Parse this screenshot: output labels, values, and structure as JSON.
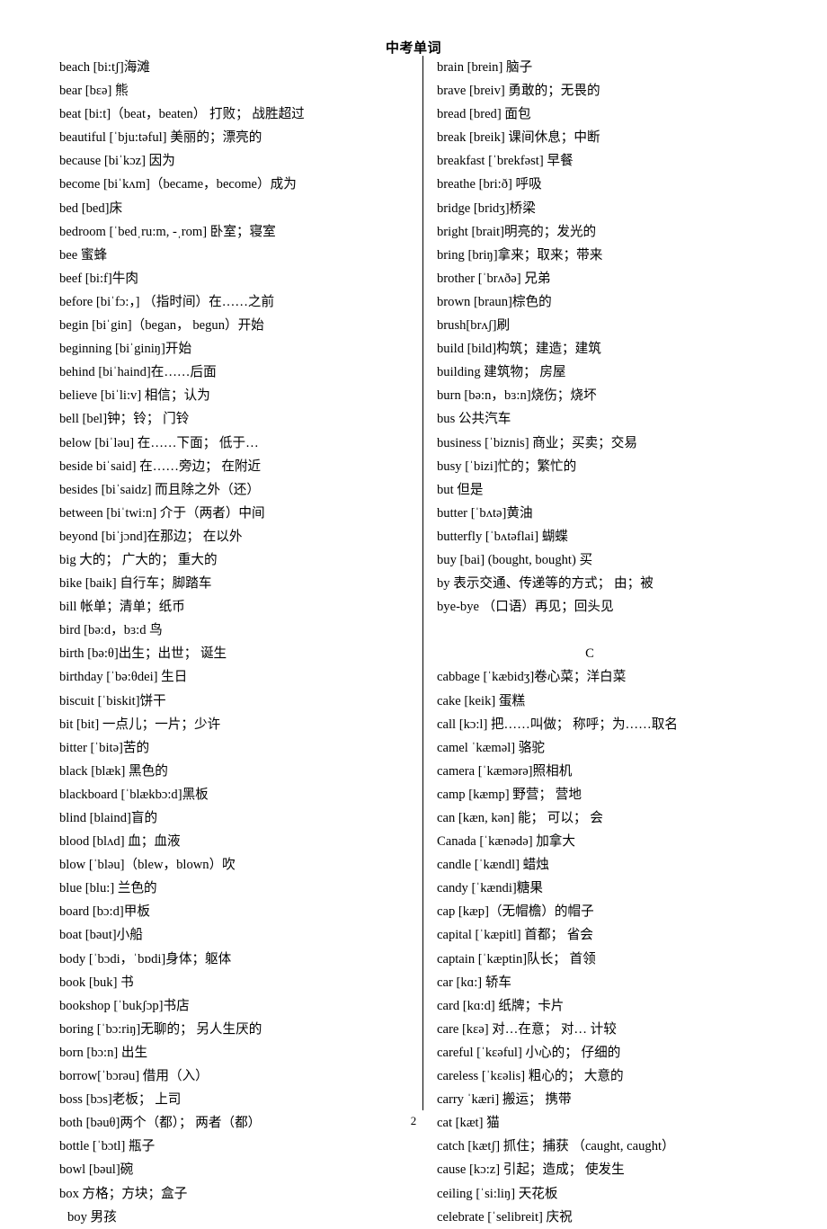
{
  "document": {
    "title": "中考单词",
    "page_number": "2"
  },
  "left_column": {
    "entries": [
      {
        "text": "beach [bi:tʃ]海滩"
      },
      {
        "text": "bear [bɛə]  熊"
      },
      {
        "text": "beat [bi:t]（beat，beaten）  打败；  战胜超过"
      },
      {
        "text": "beautiful [ˈbju:təful]  美丽的；漂亮的"
      },
      {
        "text": "because [biˈkɔz]  因为"
      },
      {
        "text": "become [biˈkʌm]（became，become）成为"
      },
      {
        "text": "bed [bed]床"
      },
      {
        "text": "bedroom [ˈbedˌru:m, -ˌrom]  卧室；寝室"
      },
      {
        "text": "bee  蜜蜂"
      },
      {
        "text": "beef [bi:f]牛肉"
      },
      {
        "text": "before [biˈfɔ:，]  （指时间）在……之前"
      },
      {
        "text": "begin [biˈgin]（began，  begun）开始"
      },
      {
        "text": "beginning   [biˈginiŋ]开始"
      },
      {
        "text": "behind [biˈhaind]在……后面"
      },
      {
        "text": "believe [biˈli:v]  相信；认为"
      },
      {
        "text": "bell [bel]钟；铃；  门铃"
      },
      {
        "text": "below [biˈləu]  在……下面；  低于…"
      },
      {
        "text": "beside biˈsaid]  在……旁边；  在附近"
      },
      {
        "text": "besides [biˈsaidz]  而且除之外（还）"
      },
      {
        "text": "between [biˈtwi:n]  介于（两者）中间"
      },
      {
        "text": "beyond [biˈjɔnd]在那边；  在以外"
      },
      {
        "text": "big  大的；  广大的；   重大的"
      },
      {
        "text": "bike [baik]  自行车；脚踏车"
      },
      {
        "text": "bill 帐单；清单；纸币"
      },
      {
        "text": "bird [bə:d，bɜ:d  鸟"
      },
      {
        "text": "birth [bə:θ]出生；出世；  诞生"
      },
      {
        "text": "birthday [ˈbə:θdei]  生日"
      },
      {
        "text": "biscuit [ˈbiskit]饼干"
      },
      {
        "text": "bit [bit]  一点儿；一片；少许"
      },
      {
        "text": "bitter [ˈbitə]苦的"
      },
      {
        "text": "black [blæk]  黑色的"
      },
      {
        "text": "blackboard [ˈblækbɔ:d]黑板"
      },
      {
        "text": "blind [blaind]盲的"
      },
      {
        "text": "blood [blʌd]  血；血液"
      },
      {
        "text": "blow [ˈbləu]（blew，blown）吹"
      },
      {
        "text": "blue [blu:]  兰色的"
      },
      {
        "text": "board [bɔ:d]甲板"
      },
      {
        "text": "boat [bəut]小船"
      },
      {
        "text": "body [ˈbɔdi，ˈbɒdi]身体；躯体"
      },
      {
        "text": "book [buk]  书"
      },
      {
        "text": "bookshop [ˈbukʃɔp]书店"
      },
      {
        "text": "boring [ˈbɔ:riŋ]无聊的；  另人生厌的"
      },
      {
        "text": "born [bɔ:n]  出生"
      },
      {
        "text": "borrow[ˈbɔrəu]  借用（入）"
      },
      {
        "text": "boss [bɔs]老板；  上司"
      },
      {
        "text": "both [bəuθ]两个（都）；  两者（都）"
      },
      {
        "text": "bottle [ˈbɔtl]  瓶子"
      },
      {
        "text": "bowl [bəul]碗"
      },
      {
        "text": "box  方格；方块；盒子"
      },
      {
        "text": "boy  男孩",
        "indented": true
      }
    ]
  },
  "right_column": {
    "entries_before_section": [
      {
        "text": "brain [brein]  脑子"
      },
      {
        "text": "brave [breiv]  勇敢的；无畏的"
      },
      {
        "text": "bread [bred]  面包"
      },
      {
        "text": "break [breik]  课间休息；中断"
      },
      {
        "text": "breakfast [ˈbrekfəst]  早餐"
      },
      {
        "text": "breathe [bri:ð]  呼吸"
      },
      {
        "text": "bridge [bridʒ]桥梁"
      },
      {
        "text": "bright [brait]明亮的；发光的"
      },
      {
        "text": "bring [briŋ]拿来；取来；带来"
      },
      {
        "text": "brother [ˈbrʌðə]  兄弟"
      },
      {
        "text": "brown [braun]棕色的"
      },
      {
        "text": "brush[brʌʃ]刷"
      },
      {
        "text": "build [bild]构筑；建造；建筑"
      },
      {
        "text": "building  建筑物；  房屋"
      },
      {
        "text": "burn [bə:n，bɜ:n]烧伤；烧坏"
      },
      {
        "text": "bus  公共汽车"
      },
      {
        "text": "business [ˈbiznis]   商业；买卖；交易"
      },
      {
        "text": "busy [ˈbizi]忙的；繁忙的"
      },
      {
        "text": "but  但是"
      },
      {
        "text": "butter [ˈbʌtə]黄油"
      },
      {
        "text": "butterfly [ˈbʌtəflai]  蝴蝶"
      },
      {
        "text": "buy [bai] (bought, bought)   买"
      },
      {
        "text": "by 表示交通、传递等的方式；  由；被"
      },
      {
        "text": "bye-bye  （口语）再见；回头见"
      }
    ],
    "section_letter": "C",
    "entries_after_section": [
      {
        "text": "cabbage [ˈkæbidʒ]卷心菜；洋白菜"
      },
      {
        "text": "cake [keik]    蛋糕"
      },
      {
        "text": "call [kɔ:l]   把……叫做；  称呼；为……取名"
      },
      {
        "text": "camel ˈkæməl]   骆驼"
      },
      {
        "text": "camera [ˈkæmərə]照相机"
      },
      {
        "text": "camp [kæmp]   野营；   营地"
      },
      {
        "text": "can [kæn, kən]   能；  可以；  会"
      },
      {
        "text": "Canada [ˈkænədə]   加拿大"
      },
      {
        "text": "candle [ˈkændl]  蜡烛"
      },
      {
        "text": "candy   [ˈkændi]糖果"
      },
      {
        "text": "cap [kæp]（无帽檐）的帽子"
      },
      {
        "text": "capital [ˈkæpitl]  首都；  省会"
      },
      {
        "text": "captain [ˈkæptin]队长；  首领"
      },
      {
        "text": "car [kɑ:]   轿车"
      },
      {
        "text": "card [kɑ:d]   纸牌；卡片"
      },
      {
        "text": "care [kɛə]   对…在意；  对… 计较"
      },
      {
        "text": "careful [ˈkɛəful]  小心的；  仔细的"
      },
      {
        "text": "careless [ˈkɛəlis]  粗心的；  大意的"
      },
      {
        "text": "carry ˈkæri]  搬运；   携带"
      },
      {
        "text": "cat [kæt]    猫"
      },
      {
        "text": "catch [kætʃ]  抓住；捕获  （caught, caught）"
      },
      {
        "text": "cause [kɔ:z]  引起；造成；  使发生"
      },
      {
        "text": "ceiling [ˈsi:liŋ]  天花板"
      },
      {
        "text": "celebrate [ˈselibreit]  庆祝"
      }
    ]
  }
}
